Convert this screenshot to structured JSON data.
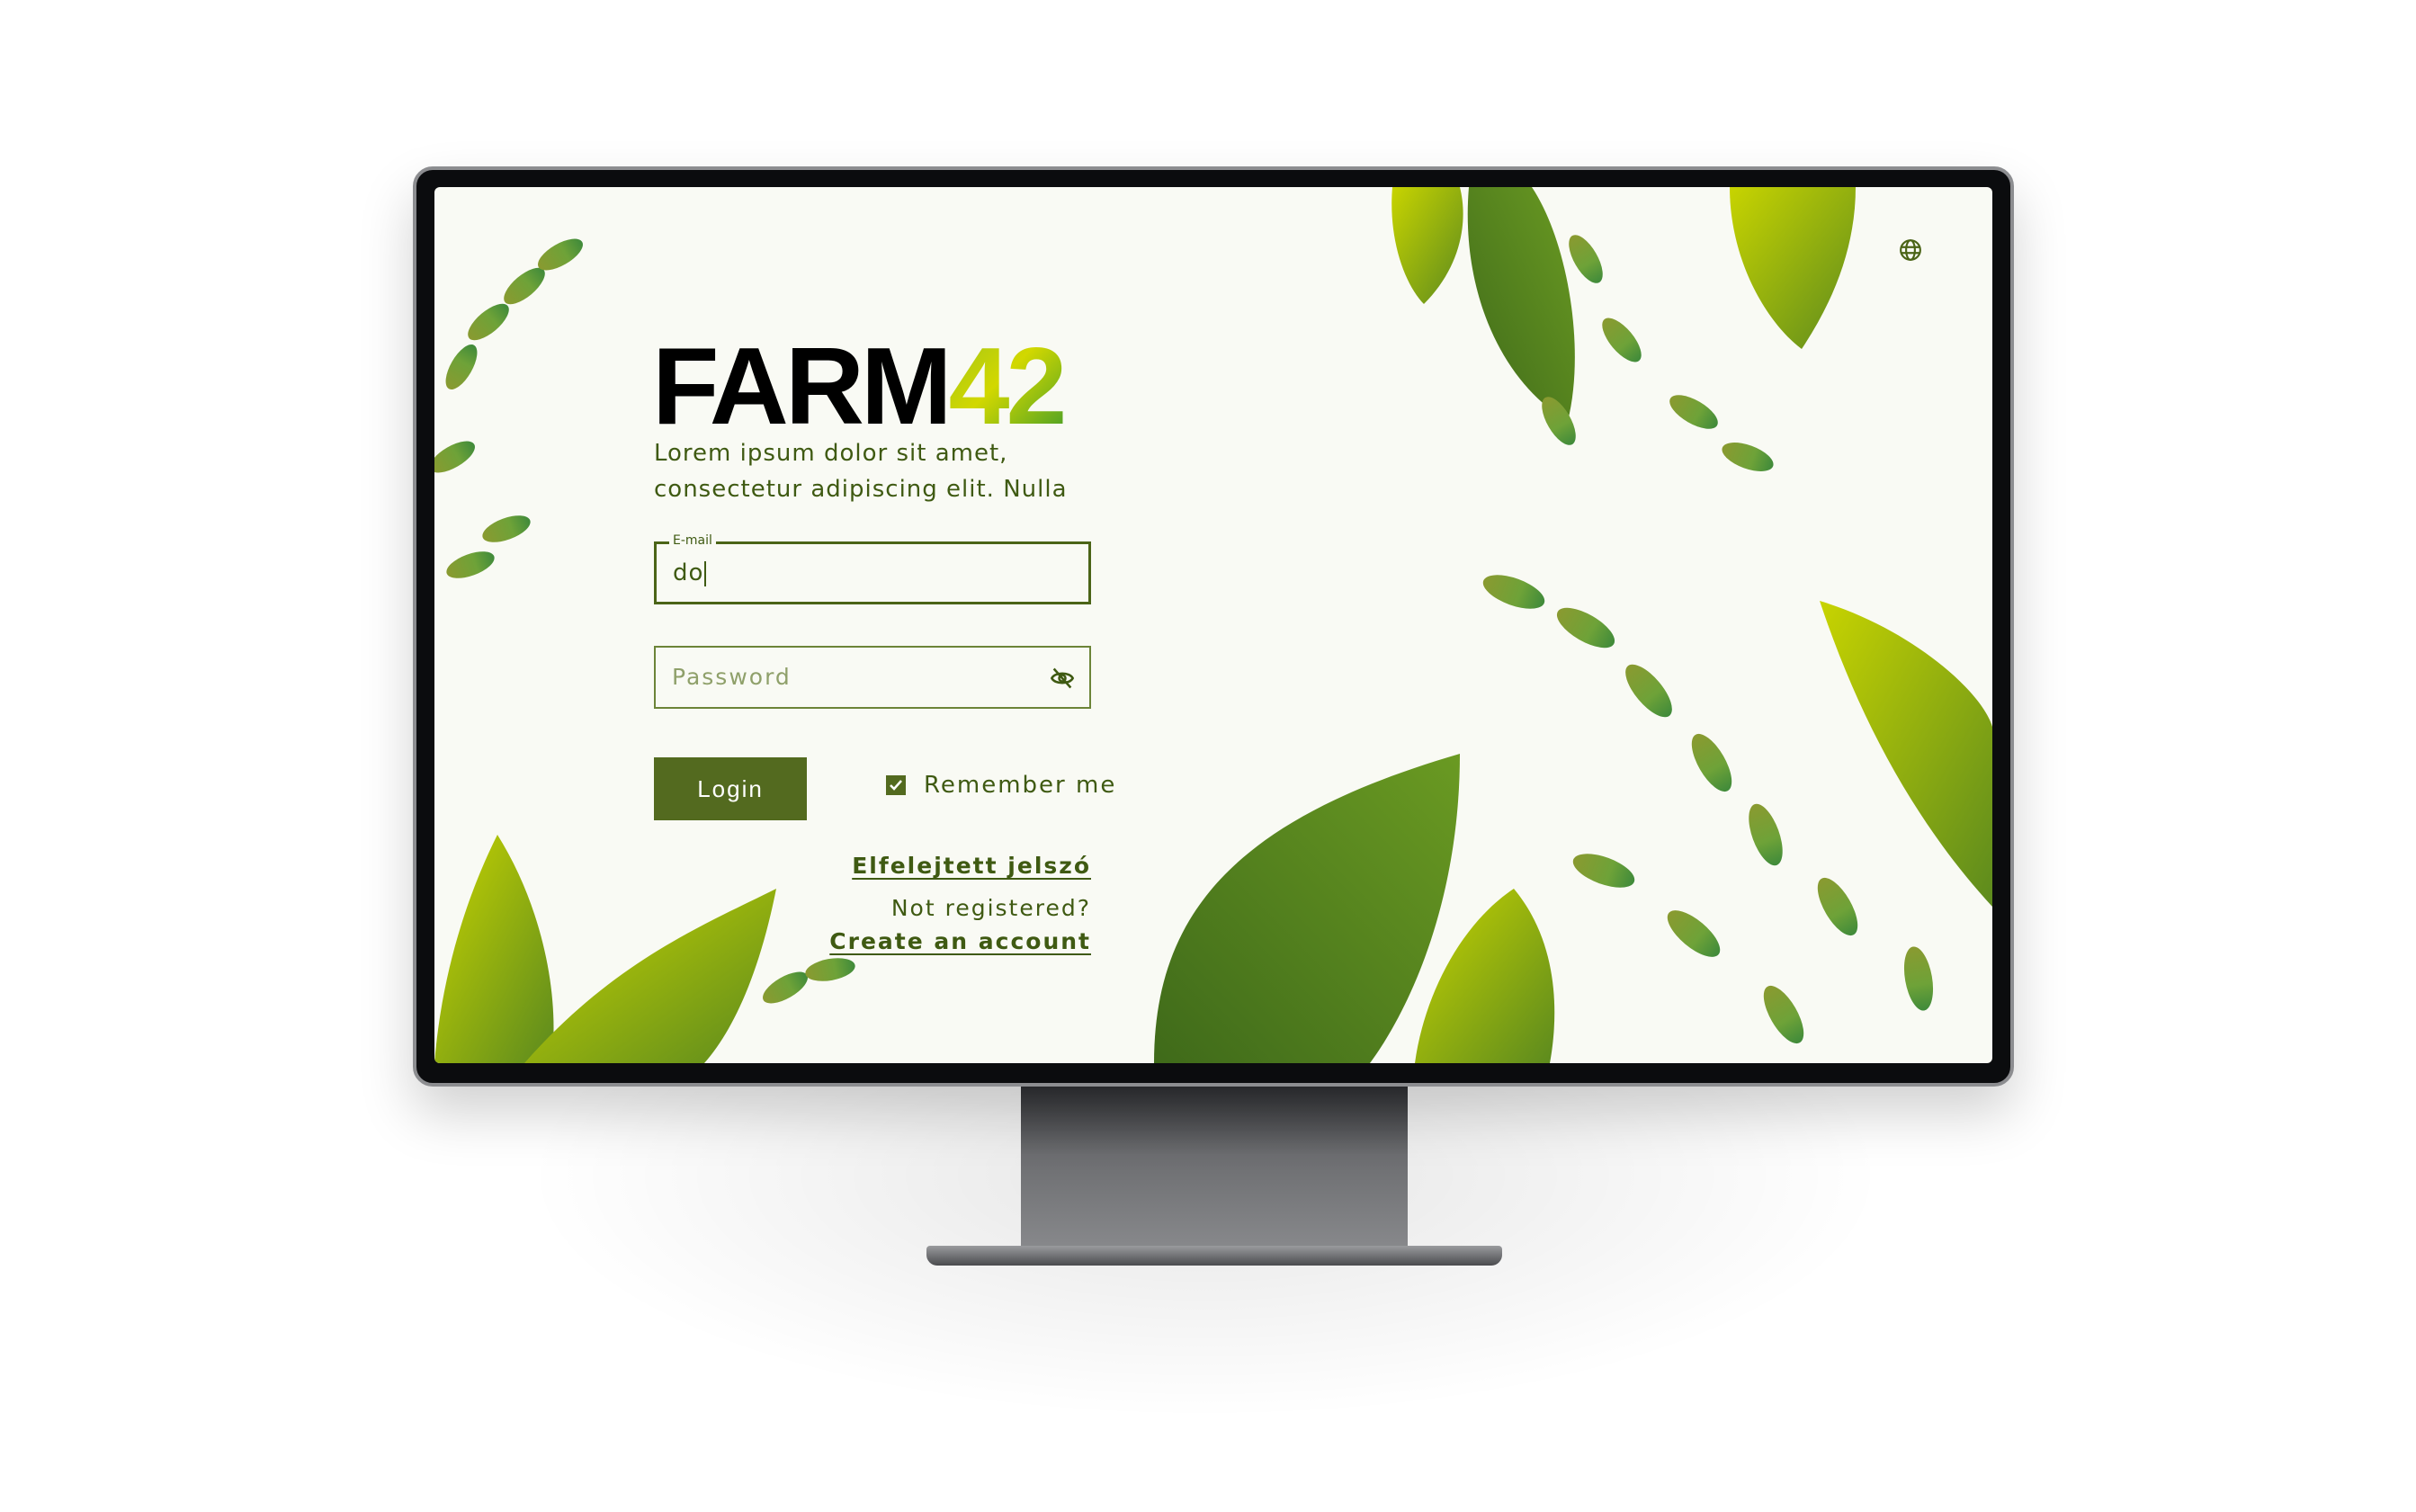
{
  "brand": {
    "word": "FARM",
    "number": "42"
  },
  "tagline": {
    "line1": "Lorem ipsum dolor sit amet,",
    "line2": "consectetur adipiscing elit. Nulla"
  },
  "email": {
    "label": "E-mail",
    "value": "do"
  },
  "password": {
    "placeholder": "Password",
    "toggle_icon": "eye-off-icon"
  },
  "login_label": "Login",
  "remember": {
    "label": "Remember me",
    "checked": true
  },
  "forgot_link": "Elfelejtett jelszó",
  "not_registered": "Not registered?",
  "create_link": "Create an account",
  "language_icon": "globe-icon",
  "colors": {
    "primary": "#536a1f",
    "text": "#3f5a12",
    "background": "#f9faf4",
    "leaf_light": "#c8d400",
    "leaf_dark": "#4f7a1c"
  }
}
